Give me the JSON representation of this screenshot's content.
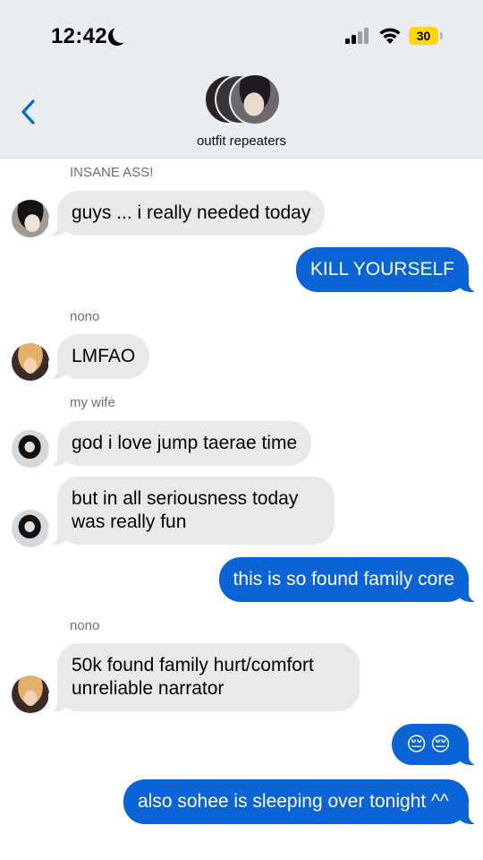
{
  "status_bar": {
    "time": "12:42",
    "battery": "30"
  },
  "header": {
    "group_name": "outfit repeaters"
  },
  "messages": [
    {
      "sender": "INSANE ASS!",
      "text": "guys ... i really needed today",
      "direction": "incoming"
    },
    {
      "text": "KILL YOURSELF",
      "direction": "outgoing"
    },
    {
      "sender": "nono",
      "text": "LMFAO",
      "direction": "incoming"
    },
    {
      "sender": "my wife",
      "text": "god i love jump taerae time",
      "direction": "incoming"
    },
    {
      "text": "but in all seriousness today was really fun",
      "direction": "incoming"
    },
    {
      "text": "this is so found family core",
      "direction": "outgoing"
    },
    {
      "sender": "nono",
      "text": "50k found family hurt/comfort unreliable narrator",
      "direction": "incoming"
    },
    {
      "text": "😔😔",
      "direction": "outgoing"
    },
    {
      "text": "also sohee is sleeping over tonight ^^",
      "direction": "outgoing"
    }
  ],
  "colors": {
    "outgoing_bubble": "#0a64d6",
    "incoming_bubble": "#e9e9eb",
    "header_bg": "#e9ecf0",
    "battery_fill": "#ffd60a"
  },
  "icons": [
    "moon-icon",
    "cellular-signal-icon",
    "wifi-icon",
    "battery-icon",
    "back-chevron-icon"
  ]
}
